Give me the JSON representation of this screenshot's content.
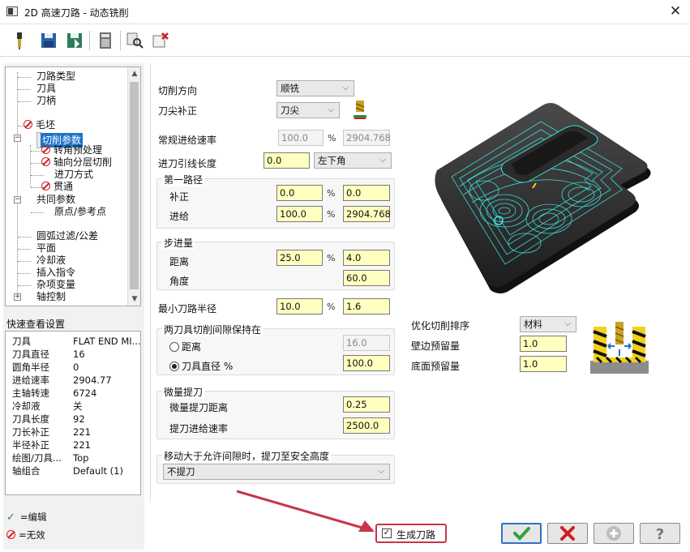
{
  "window": {
    "title": "2D 高速刀路 - 动态铣削",
    "close": "✕"
  },
  "tree": {
    "items": [
      {
        "label": "刀路类型"
      },
      {
        "label": "刀具"
      },
      {
        "label": "刀柄"
      },
      {
        "label": "毛坯"
      },
      {
        "label": "切削参数"
      },
      {
        "label": "转角预处理"
      },
      {
        "label": "轴向分层切削"
      },
      {
        "label": "进刀方式"
      },
      {
        "label": "贯通"
      },
      {
        "label": "共同参数"
      },
      {
        "label": "原点/参考点"
      },
      {
        "label": "圆弧过滤/公差"
      },
      {
        "label": "平面"
      },
      {
        "label": "冷却液"
      },
      {
        "label": "插入指令"
      },
      {
        "label": "杂项变量"
      },
      {
        "label": "轴控制"
      }
    ]
  },
  "quickview": {
    "title": "快速查看设置",
    "rows": [
      {
        "k": "刀具",
        "v": "FLAT END MI..."
      },
      {
        "k": "刀具直径",
        "v": "16"
      },
      {
        "k": "圆角半径",
        "v": "0"
      },
      {
        "k": "进给速率",
        "v": "2904.77"
      },
      {
        "k": "主轴转速",
        "v": "6724"
      },
      {
        "k": "冷却液",
        "v": "关"
      },
      {
        "k": "刀具长度",
        "v": "92"
      },
      {
        "k": "刀长补正",
        "v": "221"
      },
      {
        "k": "半径补正",
        "v": "221"
      },
      {
        "k": "绘图/刀具...",
        "v": "Top"
      },
      {
        "k": "轴组合",
        "v": "Default (1)"
      }
    ]
  },
  "legend": {
    "edit": "=编辑",
    "invalid": "=无效"
  },
  "form": {
    "cut_direction": {
      "label": "切削方向",
      "value": "顺铣"
    },
    "tip_comp": {
      "label": "刀尖补正",
      "value": "刀尖"
    },
    "feed_rate": {
      "label": "常规进给速率",
      "pct": "100.0",
      "value": "2904.768"
    },
    "lead_length": {
      "label": "进刀引线长度",
      "value": "0.0",
      "corner": "左下角"
    },
    "first_pass": {
      "title": "第一路径",
      "comp": {
        "label": "补正",
        "pct": "0.0",
        "value": "0.0"
      },
      "feed": {
        "label": "进给",
        "pct": "100.0",
        "value": "2904.768"
      }
    },
    "stepover": {
      "title": "步进量",
      "distance": {
        "label": "距离",
        "pct": "25.0",
        "value": "4.0"
      },
      "angle": {
        "label": "角度",
        "value": "60.0"
      }
    },
    "min_radius": {
      "label": "最小刀路半径",
      "pct": "10.0",
      "value": "1.6"
    },
    "gap": {
      "title": "两刀具切削间隙保持在",
      "distance": {
        "label": "距离",
        "value": "16.0"
      },
      "diameter": {
        "label": "刀具直径 %",
        "value": "100.0"
      }
    },
    "micro_lift": {
      "title": "微量提刀",
      "distance": {
        "label": "微量提刀距离",
        "value": "0.25"
      },
      "feed": {
        "label": "提刀进给速率",
        "value": "2500.0"
      }
    },
    "retract": {
      "title": "移动大于允许间隙时，提刀至安全高度",
      "value": "不提刀"
    },
    "optimize": {
      "label": "优化切削排序",
      "value": "材料"
    },
    "wall_stock": {
      "label": "壁边预留量",
      "value": "1.0"
    },
    "floor_stock": {
      "label": "底面预留量",
      "value": "1.0"
    },
    "pct_sign": "%"
  },
  "bottom": {
    "generate": "生成刀路",
    "check": "✓"
  },
  "colors": {
    "accent": "#1e74c9",
    "toolpath": "#3ee0e0",
    "highlight": "#c8354b"
  }
}
